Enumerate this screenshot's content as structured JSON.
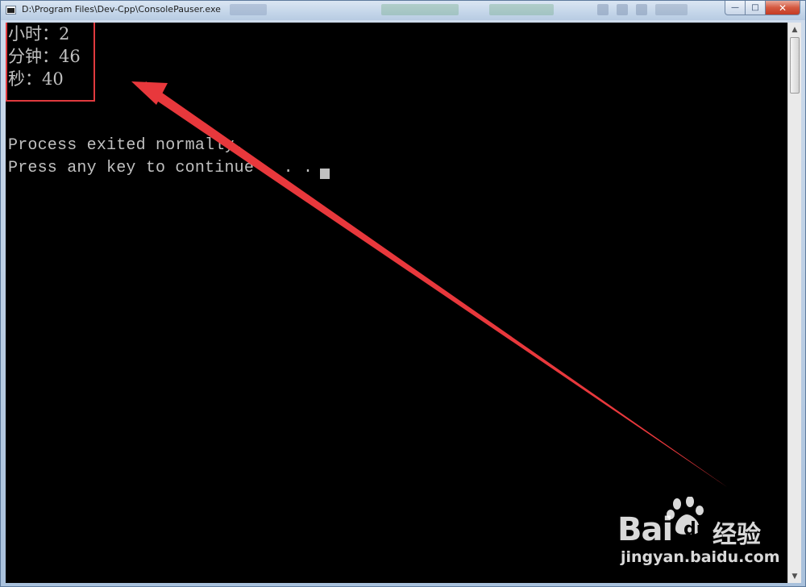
{
  "window": {
    "title": "D:\\Program Files\\Dev-Cpp\\ConsolePauser.exe",
    "controls": {
      "minimize": "—",
      "maximize": "□",
      "close": "✕"
    }
  },
  "console": {
    "lines": [
      "小时：2",
      "分钟：46",
      "秒：40",
      "Process exited normally.",
      "Press any key to continue . . ."
    ]
  },
  "scrollbar": {
    "up": "▲",
    "down": "▼"
  },
  "annotation": {
    "box_color": "#e03a3e",
    "arrow_color": "#e8383c"
  },
  "watermark": {
    "brand_bai": "Bai",
    "brand_du": "du",
    "brand_jingyan": "经验",
    "site": "jingyan.baidu.com",
    "icon": "baidu-paw-icon"
  }
}
